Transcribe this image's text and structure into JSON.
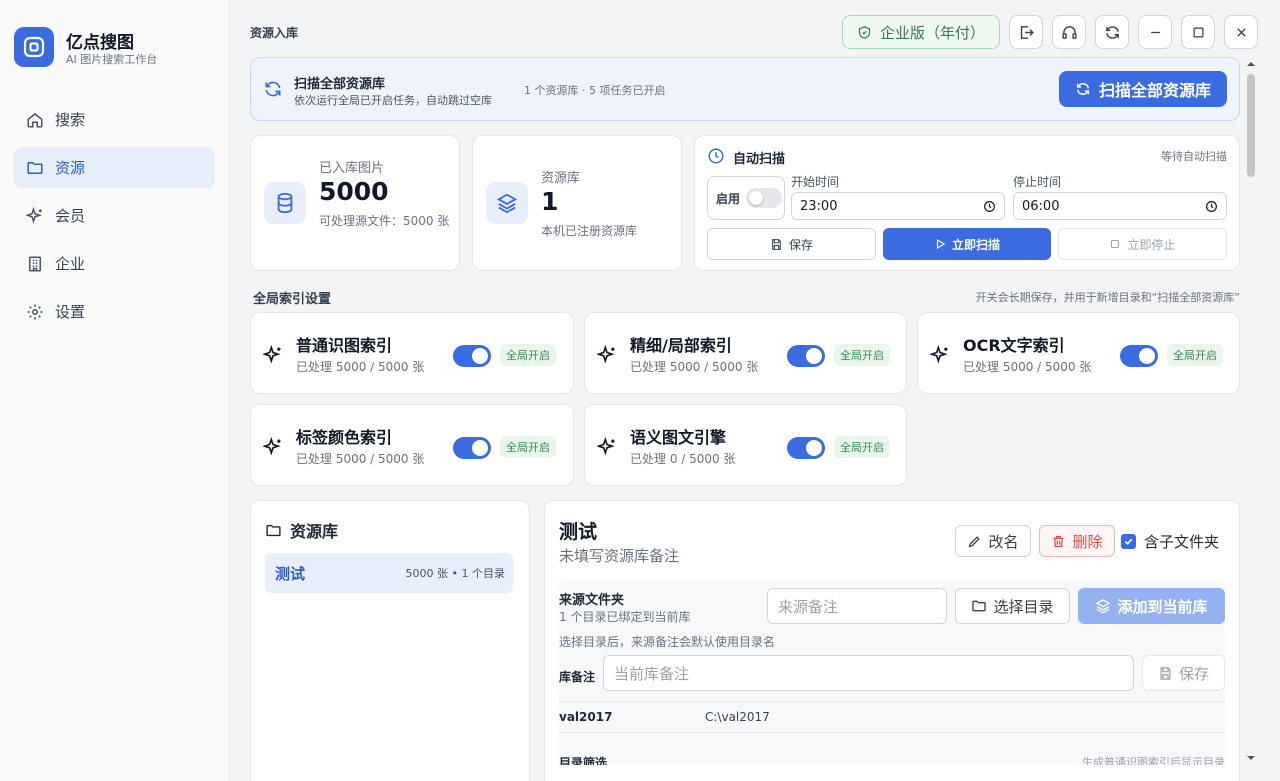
{
  "app": {
    "name": "亿点搜图",
    "subtitle": "AI 图片搜索工作台"
  },
  "nav": [
    {
      "label": "搜索",
      "icon": "home-icon"
    },
    {
      "label": "资源",
      "icon": "folder-icon",
      "active": true
    },
    {
      "label": "会员",
      "icon": "sparkle-icon"
    },
    {
      "label": "企业",
      "icon": "building-icon"
    },
    {
      "label": "设置",
      "icon": "gear-icon"
    }
  ],
  "header": {
    "breadcrumb": "资源入库",
    "edition": "企业版（年付）"
  },
  "scan_banner": {
    "title": "扫描全部资源库",
    "subtitle": "依次运行全局已开启任务，自动跳过空库",
    "meta": "1 个资源库 · 5 项任务已开启",
    "button": "扫描全部资源库"
  },
  "stats": {
    "images": {
      "label": "已入库图片",
      "value": "5000",
      "desc": "可处理源文件：5000 张"
    },
    "libraries": {
      "label": "资源库",
      "value": "1",
      "desc": "本机已注册资源库"
    }
  },
  "auto_scan": {
    "title": "自动扫描",
    "status": "等待自动扫描",
    "enable_label": "启用",
    "start_label": "开始时间",
    "start_value": "23:00",
    "stop_label": "停止时间",
    "stop_value": "06:00",
    "save": "保存",
    "scan_now": "立即扫描",
    "stop_now": "立即停止"
  },
  "global_index": {
    "title": "全局索引设置",
    "note": "开关会长期保存，并用于新增目录和“扫描全部资源库”",
    "items": [
      {
        "name": "普通识图索引",
        "progress": "已处理 5000 / 5000 张",
        "badge": "全局开启",
        "enabled": true
      },
      {
        "name": "精细/局部索引",
        "progress": "已处理 5000 / 5000 张",
        "badge": "全局开启",
        "enabled": true
      },
      {
        "name": "OCR文字索引",
        "progress": "已处理 5000 / 5000 张",
        "badge": "全局开启",
        "enabled": true
      },
      {
        "name": "标签颜色索引",
        "progress": "已处理 5000 / 5000 张",
        "badge": "全局开启",
        "enabled": true
      },
      {
        "name": "语义图文引擎",
        "progress": "已处理 0 / 5000 张",
        "badge": "全局开启",
        "enabled": true
      }
    ]
  },
  "libraries": {
    "title": "资源库",
    "items": [
      {
        "name": "测试",
        "meta": "5000 张 • 1 个目录"
      }
    ]
  },
  "detail": {
    "name": "测试",
    "remark": "未填写资源库备注",
    "rename": "改名",
    "delete": "删除",
    "include_subfolders": "含子文件夹",
    "source_title": "来源文件夹",
    "source_sub": "1 个目录已绑定到当前库",
    "source_placeholder": "来源备注",
    "choose_dir": "选择目录",
    "add_to_library": "添加到当前库",
    "source_hint": "选择目录后，来源备注会默认使用目录名",
    "library_note_label": "库备注",
    "library_note_placeholder": "当前库备注",
    "save": "保存",
    "directories": [
      {
        "name": "val2017",
        "path": "C:\\val2017"
      }
    ],
    "filter_title": "目录筛选",
    "filter_note": "生成普通识图索引后显示目录"
  }
}
